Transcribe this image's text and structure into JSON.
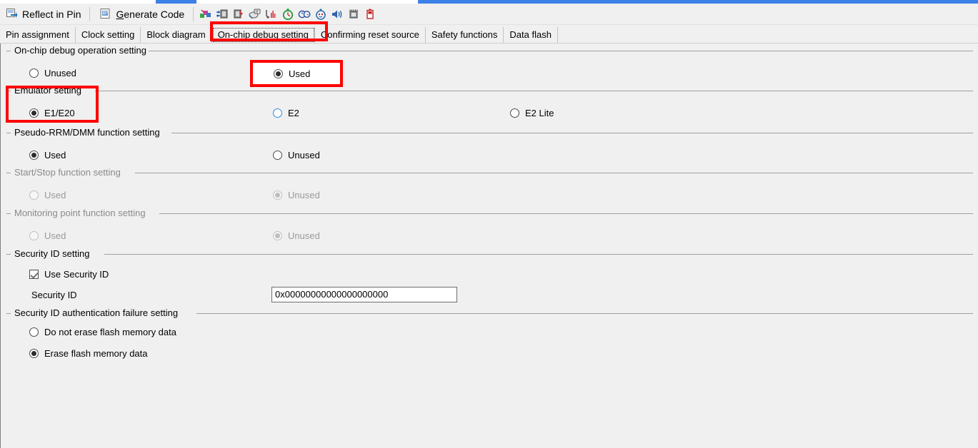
{
  "window": {
    "accent_color": "#3c80e8",
    "background_color": "#f0f0f0",
    "annotation_color": "#fe0000"
  },
  "toolbar": {
    "reflect_in_pin_label": "Reflect in Pin",
    "generate_code_label": "Generate Code",
    "generate_code_mnemonic": "G",
    "icons": [
      {
        "name": "pin-configurator-icon",
        "glyph": "⚒"
      },
      {
        "name": "clock-generator-icon",
        "glyph": "⊞"
      },
      {
        "name": "power-reset-icon",
        "glyph": "⚡"
      },
      {
        "name": "interrupt-controller-icon",
        "glyph": "✉"
      },
      {
        "name": "buses-icon",
        "glyph": "☰"
      },
      {
        "name": "timer-icon",
        "glyph": "⏱"
      },
      {
        "name": "realtime-clock-icon",
        "glyph": "◔"
      },
      {
        "name": "watchdog-timer-icon",
        "glyph": "⏰"
      },
      {
        "name": "sound-interface-icon",
        "glyph": "ὐA"
      },
      {
        "name": "serial-interface-icon",
        "glyph": "☷"
      },
      {
        "name": "voltage-detection-icon",
        "glyph": "▭"
      }
    ]
  },
  "tabs": [
    {
      "label": "Pin assignment",
      "selected": false
    },
    {
      "label": "Clock setting",
      "selected": false
    },
    {
      "label": "Block diagram",
      "selected": false
    },
    {
      "label": "On-chip debug setting",
      "selected": true
    },
    {
      "label": "Confirming reset source",
      "selected": false
    },
    {
      "label": "Safety functions",
      "selected": false
    },
    {
      "label": "Data flash",
      "selected": false
    }
  ],
  "groups": {
    "operation": {
      "title": "On-chip debug operation setting",
      "options": [
        {
          "label": "Unused",
          "checked": false,
          "disabled": false,
          "focus": false
        },
        {
          "label": "Used",
          "checked": true,
          "disabled": false,
          "focus": false
        }
      ]
    },
    "emulator": {
      "title": "Emulator setting",
      "options": [
        {
          "label": "E1/E20",
          "checked": true,
          "disabled": false,
          "focus": false
        },
        {
          "label": "E2",
          "checked": false,
          "disabled": false,
          "focus": true
        },
        {
          "label": "E2 Lite",
          "checked": false,
          "disabled": false,
          "focus": false
        }
      ]
    },
    "pseudo_rrm": {
      "title": "Pseudo-RRM/DMM function setting",
      "options": [
        {
          "label": "Used",
          "checked": true,
          "disabled": false,
          "focus": false
        },
        {
          "label": "Unused",
          "checked": false,
          "disabled": false,
          "focus": false
        }
      ]
    },
    "start_stop": {
      "title": "Start/Stop function setting",
      "disabled": true,
      "options": [
        {
          "label": "Used",
          "checked": false,
          "disabled": true,
          "focus": false
        },
        {
          "label": "Unused",
          "checked": true,
          "disabled": true,
          "focus": false
        }
      ]
    },
    "monitoring_point": {
      "title": "Monitoring point function setting",
      "disabled": true,
      "options": [
        {
          "label": "Used",
          "checked": false,
          "disabled": true,
          "focus": false
        },
        {
          "label": "Unused",
          "checked": true,
          "disabled": true,
          "focus": false
        }
      ]
    },
    "security_id": {
      "title": "Security ID setting",
      "use_security_id_label": "Use Security ID",
      "use_security_id_checked": true,
      "security_id_label": "Security ID",
      "security_id_value": "0x00000000000000000000"
    },
    "auth_failure": {
      "title": "Security ID authentication failure setting",
      "options": [
        {
          "label": "Do not erase flash memory data",
          "checked": false,
          "disabled": false,
          "focus": false
        },
        {
          "label": "Erase flash memory data",
          "checked": true,
          "disabled": false,
          "focus": false
        }
      ]
    }
  },
  "annotations": [
    {
      "name": "annotation-on-chip-debug-tab",
      "filled": false
    },
    {
      "name": "annotation-used-radio",
      "filled": true
    },
    {
      "name": "annotation-emulator-setting",
      "filled": false
    }
  ]
}
